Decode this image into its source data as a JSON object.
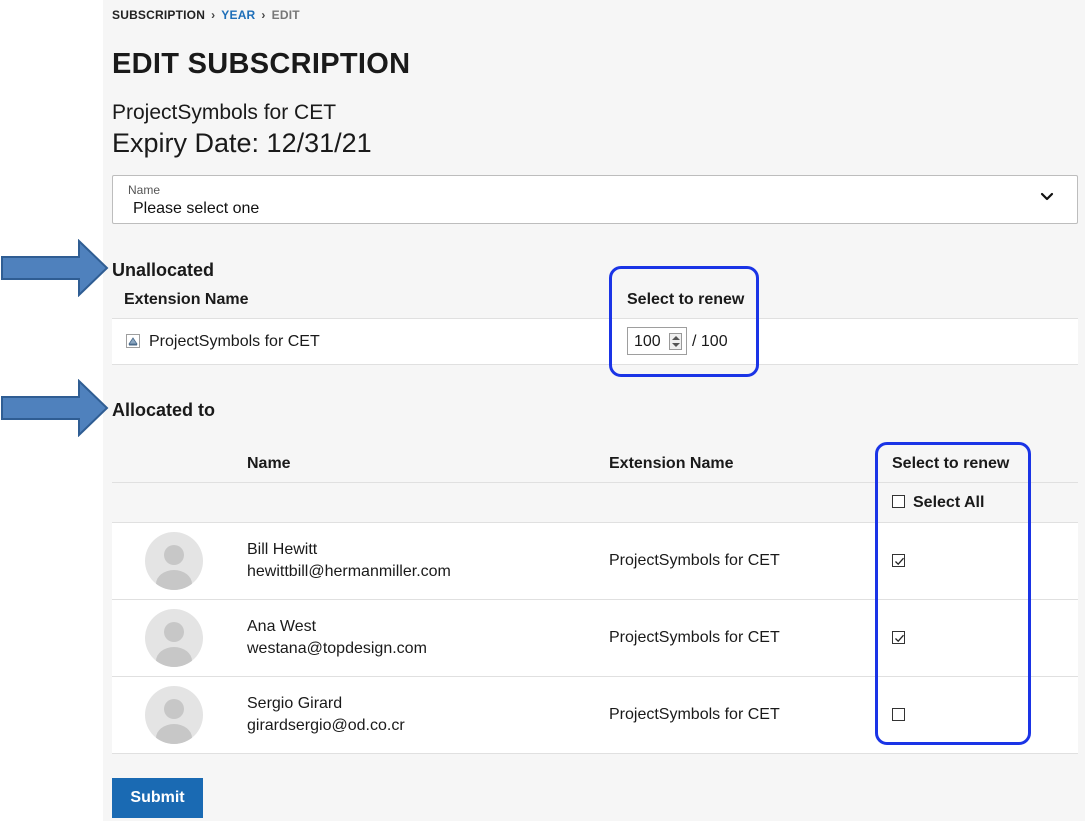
{
  "breadcrumb": {
    "items": [
      {
        "label": "SUBSCRIPTION"
      },
      {
        "label": "YEAR"
      },
      {
        "label": "EDIT"
      }
    ]
  },
  "page_title": "EDIT SUBSCRIPTION",
  "product_name": "ProjectSymbols for CET",
  "expiry": "Expiry Date: 12/31/21",
  "name_select": {
    "label": "Name",
    "value": "Please select one"
  },
  "unallocated": {
    "title": "Unallocated",
    "headers": {
      "extension": "Extension Name",
      "renew": "Select to renew"
    },
    "row": {
      "extension": "ProjectSymbols for CET",
      "renew_value": "100",
      "total": "/ 100"
    }
  },
  "allocated": {
    "title": "Allocated to",
    "headers": {
      "name": "Name",
      "extension": "Extension Name",
      "renew": "Select to renew"
    },
    "select_all_label": "Select All",
    "select_all_checked": false,
    "rows": [
      {
        "name": "Bill Hewitt",
        "email": "hewittbill@hermanmiller.com",
        "extension": "ProjectSymbols for CET",
        "checked": true
      },
      {
        "name": "Ana West",
        "email": "westana@topdesign.com",
        "extension": "ProjectSymbols for CET",
        "checked": true
      },
      {
        "name": "Sergio Girard",
        "email": "girardsergio@od.co.cr",
        "extension": "ProjectSymbols for CET",
        "checked": false
      }
    ]
  },
  "submit_label": "Submit",
  "colors": {
    "accent": "#1a6ab3",
    "link": "#1f6fb8",
    "highlight_box": "#1a34e6",
    "arrow": "#4f81bd"
  }
}
